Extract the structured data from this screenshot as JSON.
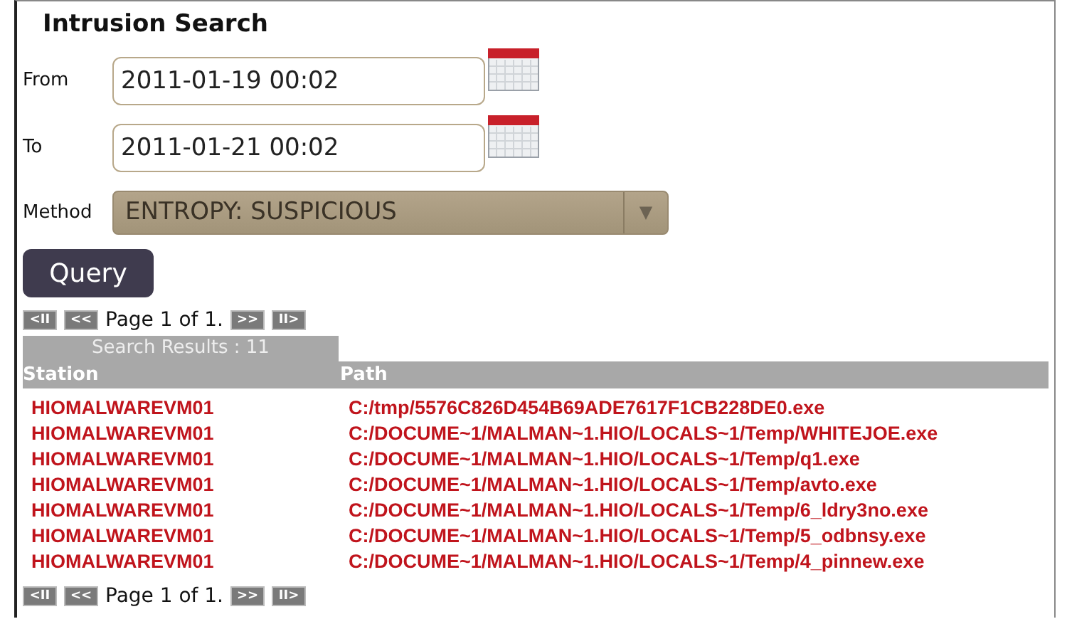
{
  "title": "Intrusion Search",
  "from": {
    "label": "From",
    "value": "2011-01-19 00:02"
  },
  "to": {
    "label": "To",
    "value": "2011-01-21 00:02"
  },
  "method": {
    "label": "Method",
    "value": "ENTROPY: SUSPICIOUS",
    "arrow": "▼"
  },
  "query_button": "Query",
  "pager_top": {
    "first": "<II",
    "prev": "<<",
    "text": "Page 1 of 1.",
    "next": ">>",
    "last": "II>"
  },
  "results_tab": "Search Results : 11",
  "table": {
    "columns": [
      "Station",
      "Path"
    ],
    "rows": [
      {
        "station": "HIOMALWAREVM01",
        "path": "C:/tmp/5576C826D454B69ADE7617F1CB228DE0.exe"
      },
      {
        "station": "HIOMALWAREVM01",
        "path": "C:/DOCUME~1/MALMAN~1.HIO/LOCALS~1/Temp/WHITEJOE.exe"
      },
      {
        "station": "HIOMALWAREVM01",
        "path": "C:/DOCUME~1/MALMAN~1.HIO/LOCALS~1/Temp/q1.exe"
      },
      {
        "station": "HIOMALWAREVM01",
        "path": "C:/DOCUME~1/MALMAN~1.HIO/LOCALS~1/Temp/avto.exe"
      },
      {
        "station": "HIOMALWAREVM01",
        "path": "C:/DOCUME~1/MALMAN~1.HIO/LOCALS~1/Temp/6_ldry3no.exe"
      },
      {
        "station": "HIOMALWAREVM01",
        "path": "C:/DOCUME~1/MALMAN~1.HIO/LOCALS~1/Temp/5_odbnsy.exe"
      },
      {
        "station": "HIOMALWAREVM01",
        "path": "C:/DOCUME~1/MALMAN~1.HIO/LOCALS~1/Temp/4_pinnew.exe"
      }
    ]
  },
  "pager_bottom": {
    "first": "<II",
    "prev": "<<",
    "text": "Page 1 of 1.",
    "next": ">>",
    "last": "II>"
  }
}
